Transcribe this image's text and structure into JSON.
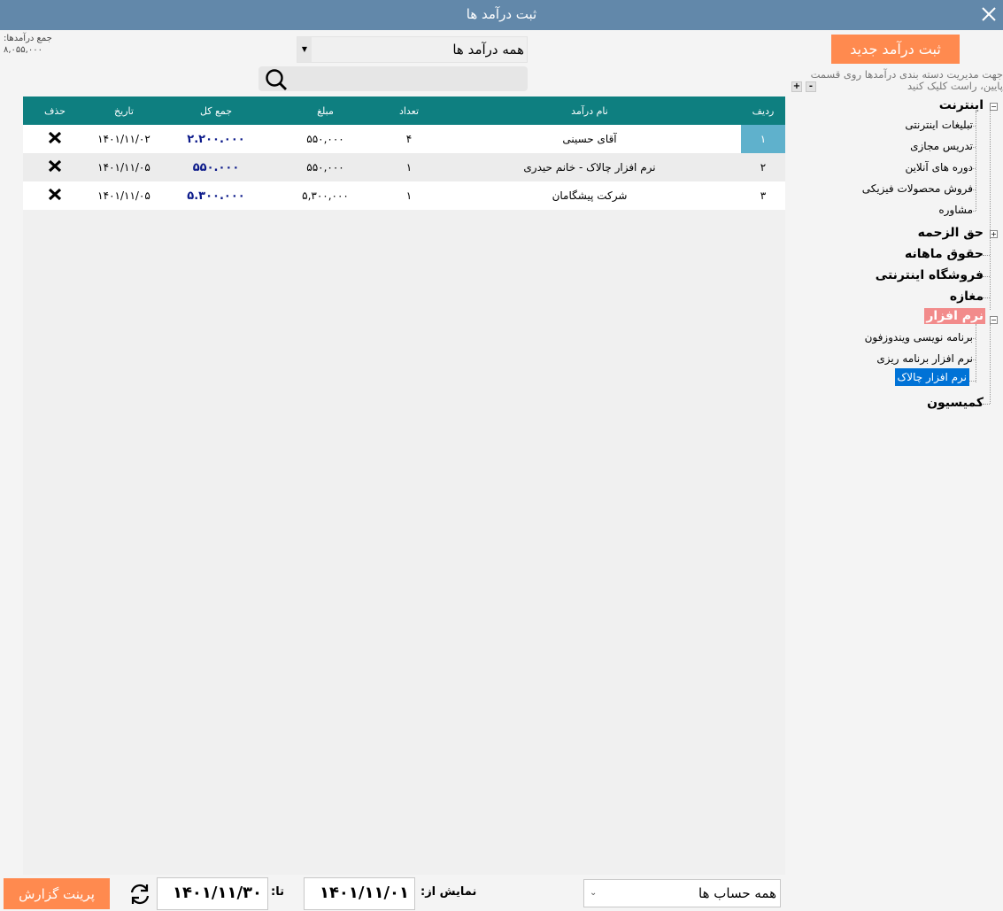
{
  "window": {
    "title": "ثبت درآمد ها"
  },
  "summary": {
    "total_label": "جمع درآمدها:",
    "total_value": "۸,۰۵۵,۰۰۰"
  },
  "category_select": {
    "value": "همه درآمد ها"
  },
  "search": {
    "placeholder": ""
  },
  "new_button": {
    "label": "ثبت درآمد جدید"
  },
  "hint": {
    "line1": "جهت مدیریت دسته بندی درآمدها روی قسمت",
    "line2": "پایین، راست کلیک کنید"
  },
  "tree_controls": {
    "expand": "+",
    "collapse": "-"
  },
  "table": {
    "headers": {
      "row": "ردیف",
      "name": "نام درآمد",
      "count": "تعداد",
      "amount": "مبلغ",
      "total": "جمع کل",
      "date": "تاریخ",
      "delete": "حذف"
    },
    "rows": [
      {
        "row": "۱",
        "name": "آقای حسینی",
        "count": "۴",
        "amount": "۵۵۰,۰۰۰",
        "total": "۲.۲۰۰.۰۰۰",
        "date": "۱۴۰۱/۱۱/۰۲"
      },
      {
        "row": "۲",
        "name": "نرم افزار چالاک - خانم حیدری",
        "count": "۱",
        "amount": "۵۵۰,۰۰۰",
        "total": "۵۵۰.۰۰۰",
        "date": "۱۴۰۱/۱۱/۰۵"
      },
      {
        "row": "۳",
        "name": "شرکت پیشگامان",
        "count": "۱",
        "amount": "۵,۳۰۰,۰۰۰",
        "total": "۵.۳۰۰.۰۰۰",
        "date": "۱۴۰۱/۱۱/۰۵"
      }
    ]
  },
  "tree": {
    "internet": {
      "label": "اینترنت",
      "children": [
        "تبلیغات اینترنتی",
        "تدریس مجازی",
        "دوره های آنلاین",
        "فروش محصولات فیزیکی",
        "مشاوره"
      ]
    },
    "haghozahme": {
      "label": "حق الزحمه"
    },
    "salary": {
      "label": "حقوق ماهانه"
    },
    "shop_online": {
      "label": "فروشگاه اینترنتی"
    },
    "store": {
      "label": "مغازه"
    },
    "software": {
      "label": "نرم افزار",
      "children": [
        "برنامه نویسی ویندوزفون",
        "نرم افزار برنامه ریزی",
        "نرم افزار چالاک"
      ]
    },
    "commission": {
      "label": "کمیسیون"
    },
    "selected_color": "#0072d6",
    "highlight_color": "#f28b8b"
  },
  "footer": {
    "print_label": "پرینت گزارش",
    "to_label": "تا:",
    "to_date": "۱۴۰۱/۱۱/۳۰",
    "from_label": "نمایش از:",
    "from_date": "۱۴۰۱/۱۱/۰۱",
    "account_select": "همه حساب ها"
  },
  "colors": {
    "titlebar": "#6288aa",
    "accent": "#ff8a4f",
    "header": "#0e7f80",
    "total_text": "#0c1a8a"
  }
}
